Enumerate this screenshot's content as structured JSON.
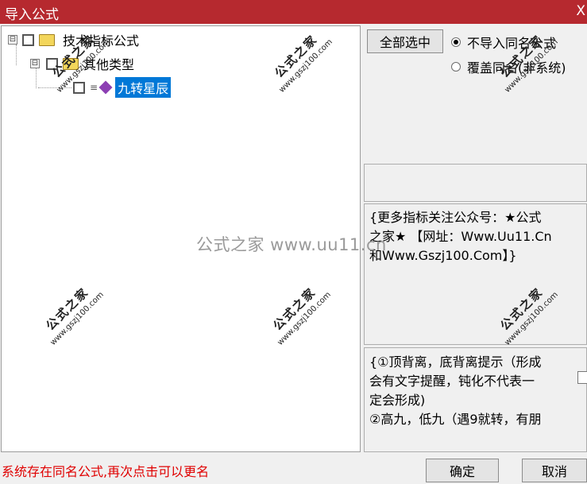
{
  "window": {
    "title": "导入公式",
    "close_glyph": "X"
  },
  "tree": {
    "root": {
      "expander": "⊟",
      "label": "技术指标公式"
    },
    "group": {
      "expander": "⊟",
      "label": "其他类型"
    },
    "leaf": {
      "label": "九转星辰"
    }
  },
  "right_panel": {
    "select_all_label": "全部选中",
    "radio_options": [
      "不导入同名公式",
      "覆盖同名(非系统)"
    ],
    "info_text_lines": [
      "{更多指标关注公众号：★公式",
      "之家★ 【网址：Www.Uu11.Cn",
      "和Www.Gszj100.Com】}"
    ],
    "desc_text_lines": [
      "{①顶背离，底背离提示（形成",
      "会有文字提醒，钝化不代表一",
      "定会形成)",
      "②高九，低九（遇9就转，有朋"
    ]
  },
  "status_message": "系统存在同名公式,再次点击可以更名",
  "buttons": {
    "ok": "确定",
    "cancel": "取消"
  },
  "watermark": {
    "center_text": "公式之家 www.uu11.cn",
    "stamp_cn": "公式之家",
    "stamp_url": "www.gszj100.com"
  },
  "colors": {
    "titlebar": "#b6292f",
    "status_text": "#e00000",
    "selection": "#0078d7"
  },
  "icons": [
    "tree-expander-icon",
    "checkbox-icon",
    "folder-icon",
    "formula-gem-icon",
    "radio-icon"
  ]
}
